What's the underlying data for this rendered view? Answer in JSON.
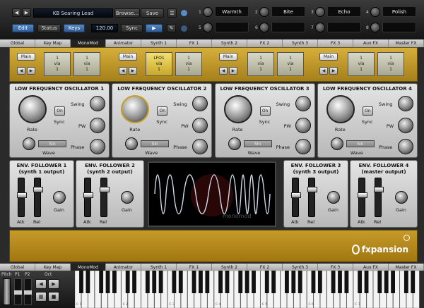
{
  "topbar": {
    "preset_name": "KB Searing Lead",
    "browse_label": "Browse...",
    "save_label": "Save",
    "edit_label": "Edit",
    "status_label": "Status",
    "keys_label": "Keys",
    "tempo": "120.00",
    "sync_label": "Sync",
    "fx_knobs": [
      {
        "num": "1",
        "name": "Warmth"
      },
      {
        "num": "2",
        "name": "Bite"
      },
      {
        "num": "3",
        "name": "Echo"
      },
      {
        "num": "4",
        "name": "Polish"
      },
      {
        "num": "5",
        "name": ""
      },
      {
        "num": "6",
        "name": ""
      },
      {
        "num": "7",
        "name": ""
      },
      {
        "num": "8",
        "name": ""
      }
    ]
  },
  "tabs": [
    "Global",
    "Key Map",
    "MonoMod",
    "Animator",
    "Synth 1",
    "FX 1",
    "Synth 2",
    "FX 2",
    "Synth 3",
    "FX 3",
    "Aux FX",
    "Master FX"
  ],
  "active_tab": "MonoMod",
  "modstrip": {
    "main_label": "Main",
    "slots": [
      {
        "l1": "1",
        "l2": "via",
        "l3": "1"
      },
      {
        "l1": "1",
        "l2": "via",
        "l3": "1"
      },
      {
        "l1": "LFO1",
        "l2": "via",
        "l3": "1"
      },
      {
        "l1": "1",
        "l2": "via",
        "l3": "1"
      },
      {
        "l1": "1",
        "l2": "via",
        "l3": "1"
      },
      {
        "l1": "1",
        "l2": "via",
        "l3": "1"
      },
      {
        "l1": "1",
        "l2": "via",
        "l3": "1"
      },
      {
        "l1": "1",
        "l2": "via",
        "l3": "1"
      }
    ]
  },
  "lfos": [
    {
      "title": "LOW FREQUENCY OSCILLATOR 1"
    },
    {
      "title": "LOW FREQUENCY OSCILLATOR 2"
    },
    {
      "title": "LOW FREQUENCY OSCILLATOR 3"
    },
    {
      "title": "LOW FREQUENCY OSCILLATOR 4"
    }
  ],
  "lfo_labels": {
    "rate": "Rate",
    "sync": "Sync",
    "on": "On",
    "swing": "Swing",
    "pw": "PW",
    "phase": "Phase",
    "wave": "Wave",
    "wave_value": "Sin"
  },
  "env": [
    {
      "title1": "ENV. FOLLOWER 1",
      "title2": "(synth 1 output)"
    },
    {
      "title1": "ENV. FOLLOWER 2",
      "title2": "(synth 2 output)"
    },
    {
      "title1": "ENV. FOLLOWER 3",
      "title2": "(synth 3 output)"
    },
    {
      "title1": "ENV. FOLLOWER 4",
      "title2": "(master output)"
    }
  ],
  "env_labels": {
    "atk": "Atk",
    "rel": "Rel",
    "gain": "Gain"
  },
  "scope_watermark": "monomod",
  "brand": "fxpansion",
  "bottom": {
    "pitch": "Pitch",
    "p1": "P1",
    "p2": "P2",
    "oct": "Oct",
    "octave_labels": [
      "C 1",
      "C 2",
      "C 3",
      "C 4",
      "C 5",
      "C 6",
      "C 7"
    ]
  },
  "colors": {
    "accent_blue": "#3f6fad",
    "gold": "#c9a020"
  }
}
